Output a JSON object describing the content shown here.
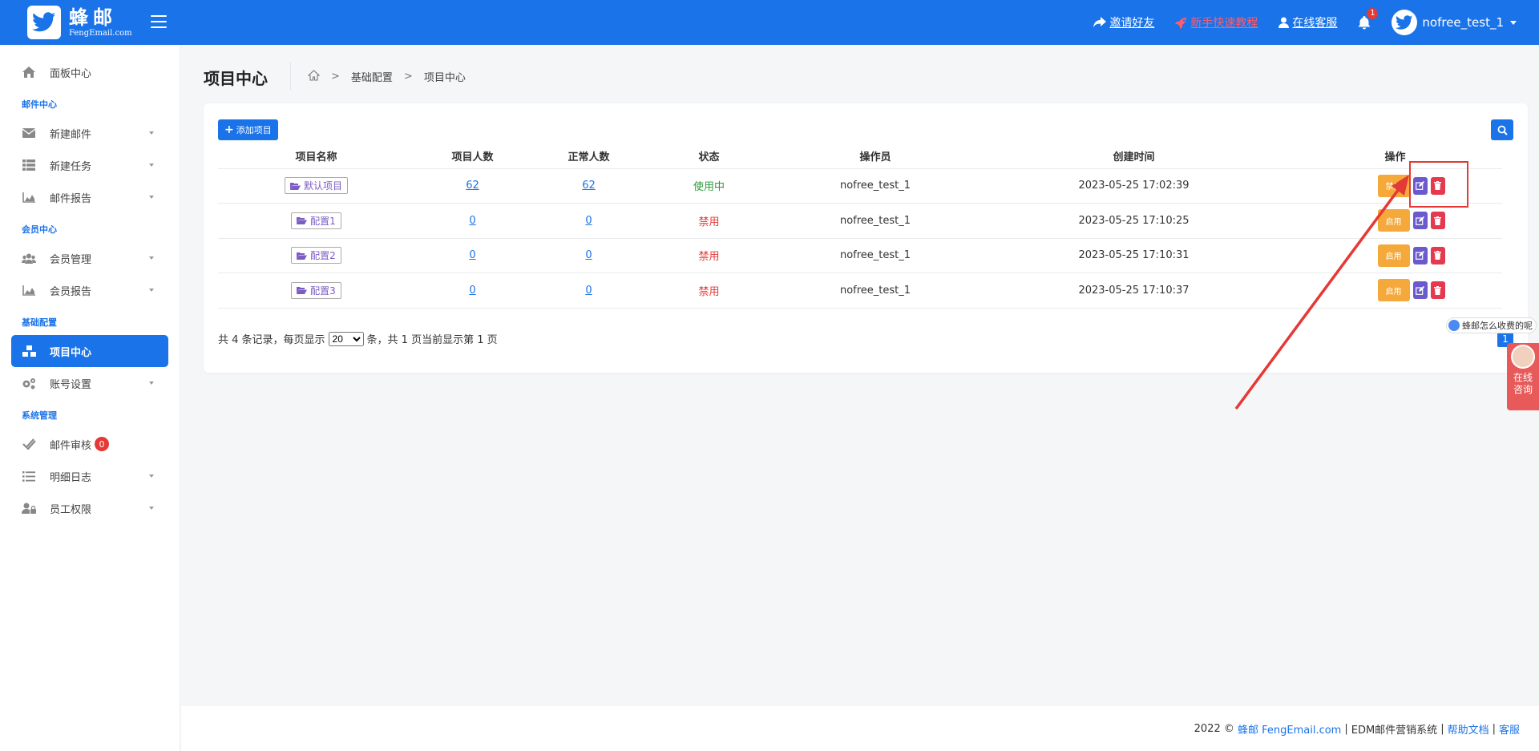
{
  "brand": {
    "name": "蜂邮",
    "sub": "FengEmail.com"
  },
  "topbar": {
    "invite": "邀请好友",
    "tutorial": "新手快速教程",
    "service": "在线客服",
    "notif_count": "1",
    "username": "nofree_test_1",
    "colors": {
      "primary": "#1a73e8",
      "tutorial": "#ff5c6c"
    }
  },
  "sidebar": {
    "dashboard": "面板中心",
    "groups": {
      "mail": "邮件中心",
      "member": "会员中心",
      "basic": "基础配置",
      "system": "系统管理"
    },
    "items": {
      "new_mail": "新建邮件",
      "new_task": "新建任务",
      "mail_report": "邮件报告",
      "member_mgmt": "会员管理",
      "member_report": "会员报告",
      "project_center": "项目中心",
      "account_settings": "账号设置",
      "mail_review": "邮件审核",
      "review_count": "0",
      "detail_log": "明细日志",
      "staff_perm": "员工权限"
    }
  },
  "page": {
    "title": "项目中心",
    "breadcrumb": [
      "基础配置",
      "项目中心"
    ]
  },
  "toolbar": {
    "add_label": "添加项目"
  },
  "table": {
    "headers": [
      "项目名称",
      "项目人数",
      "正常人数",
      "状态",
      "操作员",
      "创建时间",
      "操作"
    ],
    "rows": [
      {
        "name": "默认项目",
        "count": "62",
        "normal": "62",
        "status": "使用中",
        "status_type": "green",
        "operator": "nofree_test_1",
        "created": "2023-05-25 17:02:39",
        "toggle": "禁用"
      },
      {
        "name": "配置1",
        "count": "0",
        "normal": "0",
        "status": "禁用",
        "status_type": "red",
        "operator": "nofree_test_1",
        "created": "2023-05-25 17:10:25",
        "toggle": "启用"
      },
      {
        "name": "配置2",
        "count": "0",
        "normal": "0",
        "status": "禁用",
        "status_type": "red",
        "operator": "nofree_test_1",
        "created": "2023-05-25 17:10:31",
        "toggle": "启用"
      },
      {
        "name": "配置3",
        "count": "0",
        "normal": "0",
        "status": "禁用",
        "status_type": "red",
        "operator": "nofree_test_1",
        "created": "2023-05-25 17:10:37",
        "toggle": "启用"
      }
    ]
  },
  "pager": {
    "prefix": "共 4 条记录，每页显示",
    "page_size": "20",
    "suffix": "条，共 1 页当前显示第 1 页",
    "current": "1"
  },
  "chat": {
    "bubble": "蜂邮怎么收费的呢",
    "widget_line1": "在线",
    "widget_line2": "咨询"
  },
  "footer": {
    "year": "2022 ©",
    "brand_link": "蜂邮 FengEmail.com",
    "desc": "EDM邮件营销系统",
    "help": "帮助文档",
    "support": "客服"
  }
}
